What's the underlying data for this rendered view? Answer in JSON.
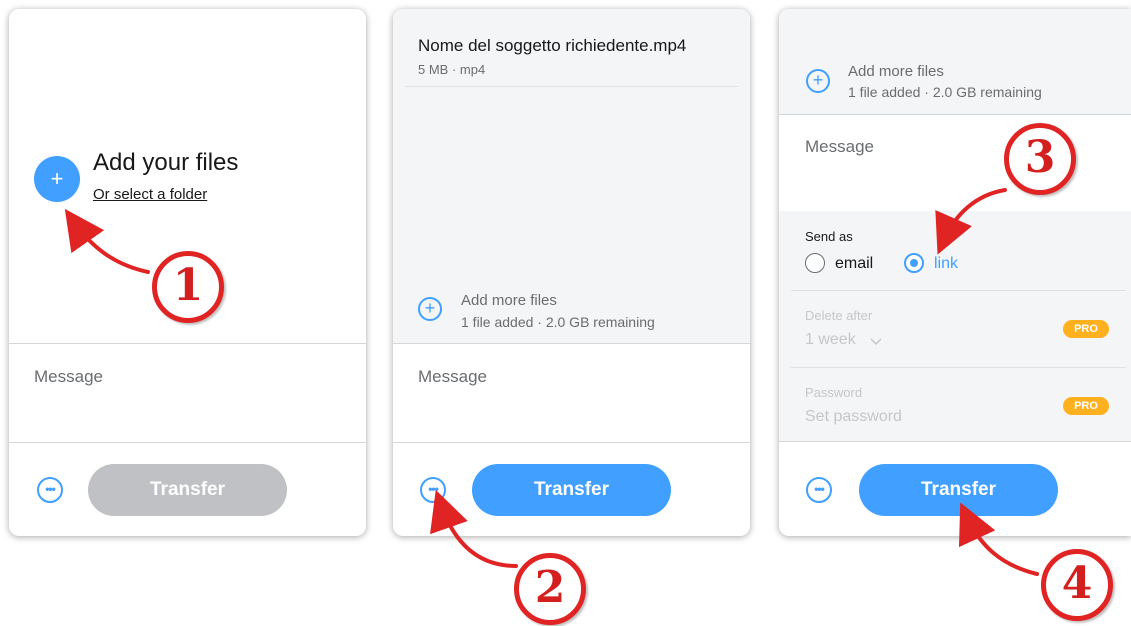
{
  "colors": {
    "accent": "#409fff",
    "disabled": "#bfc1c4",
    "pro": "#ffb01f",
    "annotation": "#e02424"
  },
  "panel1": {
    "add_title": "Add your files",
    "add_subtitle": "Or select a folder",
    "add_icon": "+",
    "message_placeholder": "Message",
    "more_icon": "•••",
    "transfer_label": "Transfer"
  },
  "panel2": {
    "file": {
      "name": "Nome del soggetto richiedente.mp4",
      "meta": "5 MB · mp4"
    },
    "add_more_icon": "+",
    "add_more_title": "Add more files",
    "add_more_sub": "1 file added · 2.0 GB remaining",
    "message_placeholder": "Message",
    "more_icon": "•••",
    "transfer_label": "Transfer"
  },
  "panel3": {
    "add_more_icon": "+",
    "add_more_title": "Add more files",
    "add_more_sub": "1 file added · 2.0 GB remaining",
    "message_placeholder": "Message",
    "send_as_label": "Send as",
    "option_email": "email",
    "option_link": "link",
    "delete_after_label": "Delete after",
    "delete_after_value": "1 week",
    "password_label": "Password",
    "password_placeholder": "Set password",
    "pro_badge": "PRO",
    "more_icon": "•••",
    "transfer_label": "Transfer"
  },
  "annotations": {
    "step1": "1",
    "step2": "2",
    "step3": "3",
    "step4": "4"
  }
}
